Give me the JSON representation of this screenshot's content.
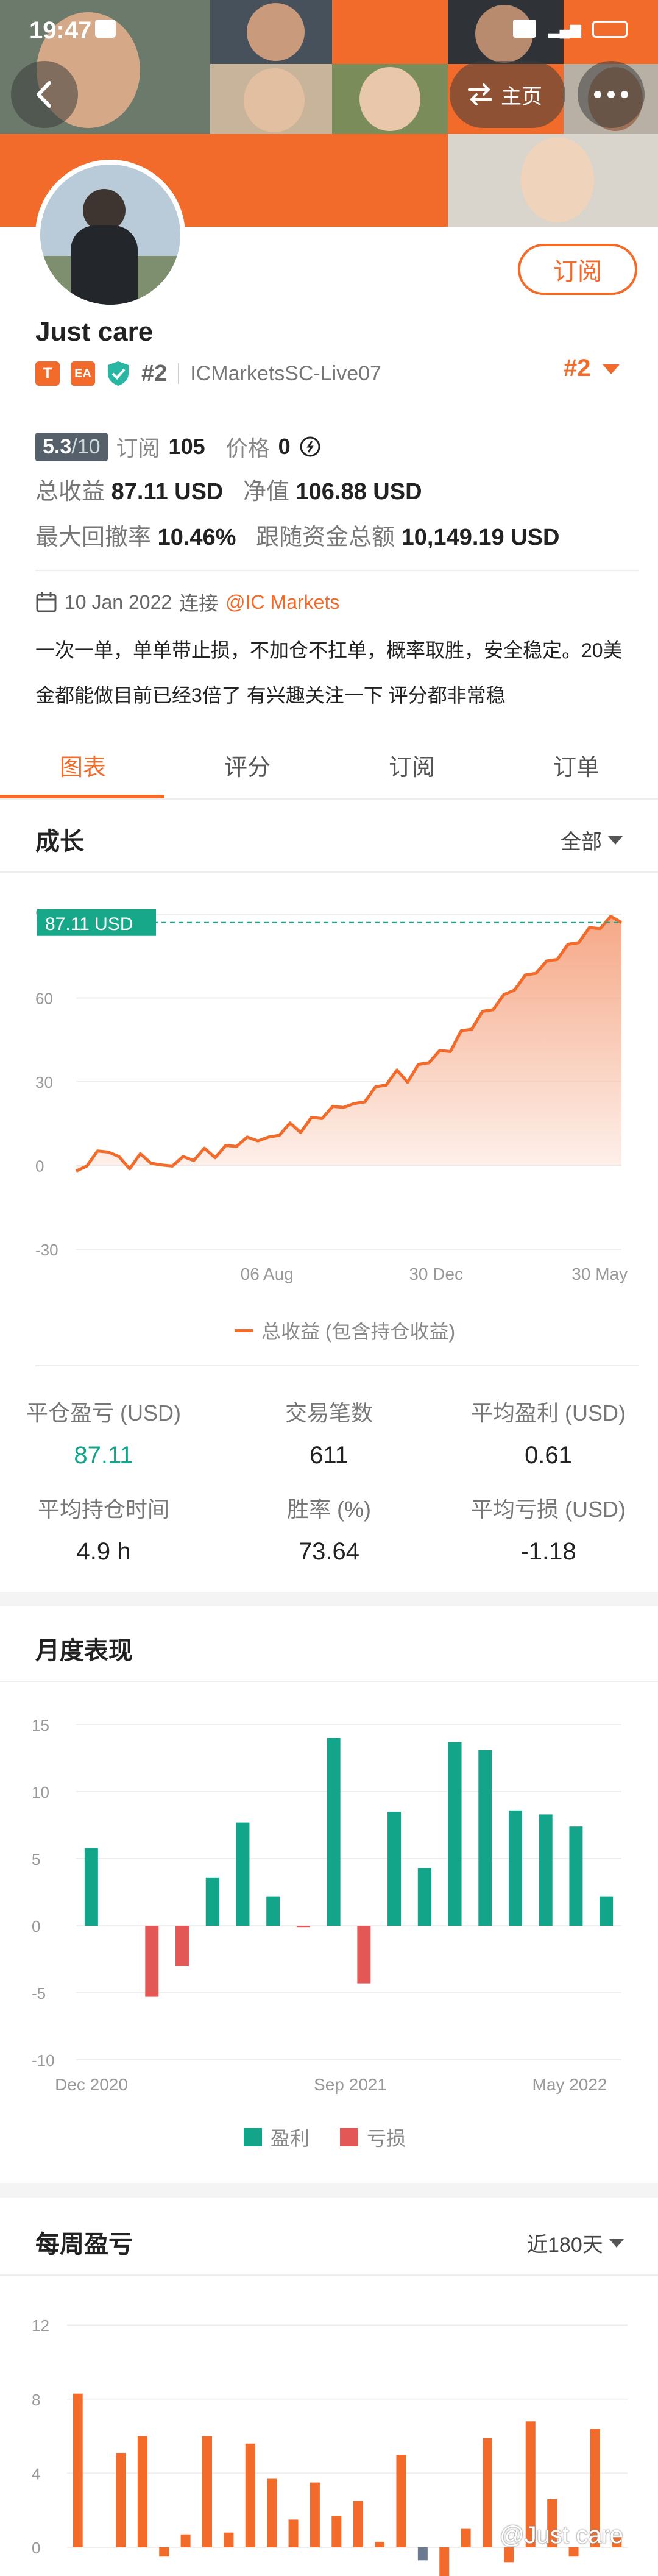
{
  "status_bar": {
    "time": "19:47"
  },
  "header": {
    "home_label": "主页",
    "colors": {
      "accent": "#f26b2a"
    }
  },
  "profile": {
    "name": "Just care",
    "badges": [
      "T",
      "EA"
    ],
    "rank": "#2",
    "account": "ICMarketsSC-Live07",
    "rank_right": "#2",
    "subscribe_label": "订阅",
    "score": "5.3",
    "score_max": "/10",
    "subs_label": "订阅",
    "subs_count": "105",
    "price_label": "价格",
    "price_value": "0",
    "total_profit_label": "总收益",
    "total_profit_value": "87.11 USD",
    "equity_label": "净值",
    "equity_value": "106.88 USD",
    "drawdown_label": "最大回撤率",
    "drawdown_value": "10.46%",
    "follow_label": "跟随资金总额",
    "follow_value": "10,149.19 USD",
    "since_date": "10 Jan 2022",
    "since_connect": "连接",
    "broker_link": "@IC Markets",
    "description": "一次一单，单单带止损，不加仓不扛单，概率取胜，安全稳定。20美金都能做目前已经3倍了 有兴趣关注一下 评分都非常稳"
  },
  "tabs": [
    {
      "label": "图表"
    },
    {
      "label": "评分"
    },
    {
      "label": "订阅"
    },
    {
      "label": "订单"
    }
  ],
  "growth": {
    "title": "成长",
    "range_label": "全部",
    "current_value_label": "87.11 USD",
    "legend": "总收益 (包含持仓收益)",
    "colors": {
      "line": "#f26b2a",
      "fill_top": "#f5a380",
      "label_bg": "#17a88a"
    }
  },
  "metrics": [
    {
      "label": "平仓盈亏 (USD)",
      "value": "87.11"
    },
    {
      "label": "交易笔数",
      "value": "611"
    },
    {
      "label": "平均盈利 (USD)",
      "value": "0.61"
    },
    {
      "label": "平均持仓时间",
      "value": "4.9 h"
    },
    {
      "label": "胜率 (%)",
      "value": "73.64"
    },
    {
      "label": "平均亏损 (USD)",
      "value": "-1.18"
    }
  ],
  "monthly": {
    "title": "月度表现",
    "legend_profit": "盈利",
    "legend_loss": "亏损",
    "colors": {
      "profit": "#13a58a",
      "loss": "#e45757"
    }
  },
  "weekly": {
    "title": "每周盈亏",
    "range_label": "近180天",
    "watermark": "@Just care",
    "colors": {
      "bar": "#f26b2a",
      "neg": "#6b7a90"
    }
  },
  "chart_data": [
    {
      "type": "area",
      "title": "成长",
      "x_tick_labels": [
        "06 Aug",
        "30 Dec",
        "30 May"
      ],
      "y_ticks": [
        -30,
        0,
        30,
        60,
        90
      ],
      "ylim": [
        -30,
        90
      ],
      "series": [
        {
          "name": "总收益 (包含持仓收益)",
          "values": [
            -2,
            1,
            4,
            6,
            2,
            0,
            3,
            2,
            -1,
            1,
            2,
            3,
            5,
            4,
            6,
            8,
            9,
            10,
            9,
            12,
            14,
            13,
            16,
            18,
            20,
            22,
            21,
            24,
            27,
            30,
            33,
            31,
            35,
            38,
            40,
            42,
            47,
            50,
            54,
            57,
            60,
            64,
            67,
            70,
            72,
            75,
            78,
            81,
            84,
            86,
            88,
            87
          ]
        }
      ]
    },
    {
      "type": "bar",
      "title": "月度表现",
      "x_tick_labels": [
        "Dec 2020",
        "Sep 2021",
        "May 2022"
      ],
      "y_ticks": [
        -10,
        -5,
        0,
        5,
        10,
        15
      ],
      "ylim": [
        -10,
        15
      ],
      "values": [
        5.8,
        0,
        -5.3,
        -3.0,
        3.6,
        7.7,
        2.2,
        -0.1,
        14.0,
        -4.3,
        8.5,
        4.3,
        13.7,
        13.1,
        8.6,
        8.3,
        7.4,
        2.2
      ]
    },
    {
      "type": "bar",
      "title": "每周盈亏",
      "y_ticks": [
        0,
        4,
        8,
        12
      ],
      "ylim": [
        -2,
        13
      ],
      "values": [
        8.3,
        0,
        5.1,
        6.0,
        -0.5,
        0.7,
        6.0,
        0.8,
        5.6,
        3.7,
        1.5,
        3.5,
        1.7,
        2.5,
        0.3,
        5.0,
        -0.7,
        -2.0,
        1.0,
        5.9,
        -0.8,
        6.8,
        2.6,
        -0.5,
        6.4,
        0.6
      ]
    }
  ]
}
